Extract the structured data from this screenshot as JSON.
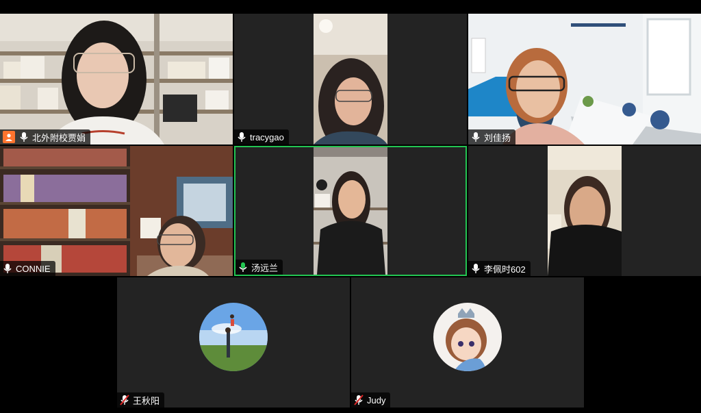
{
  "participants": [
    {
      "name": "北外附校贾娟",
      "mic": "on",
      "host": true
    },
    {
      "name": "tracygao",
      "mic": "on"
    },
    {
      "name": "刘佳扬",
      "mic": "on"
    },
    {
      "name": "CONNIE",
      "mic": "on"
    },
    {
      "name": "汤远兰",
      "mic": "active",
      "speaking": true
    },
    {
      "name": "李佩时602",
      "mic": "on"
    },
    {
      "name": "王秋阳",
      "mic": "muted",
      "video": "off"
    },
    {
      "name": "Judy",
      "mic": "muted",
      "video": "off"
    }
  ],
  "colors": {
    "tile_bg": "#232323",
    "speaker_border": "#23c552",
    "muted_red": "#e02828",
    "host_orange": "#ff742e"
  }
}
